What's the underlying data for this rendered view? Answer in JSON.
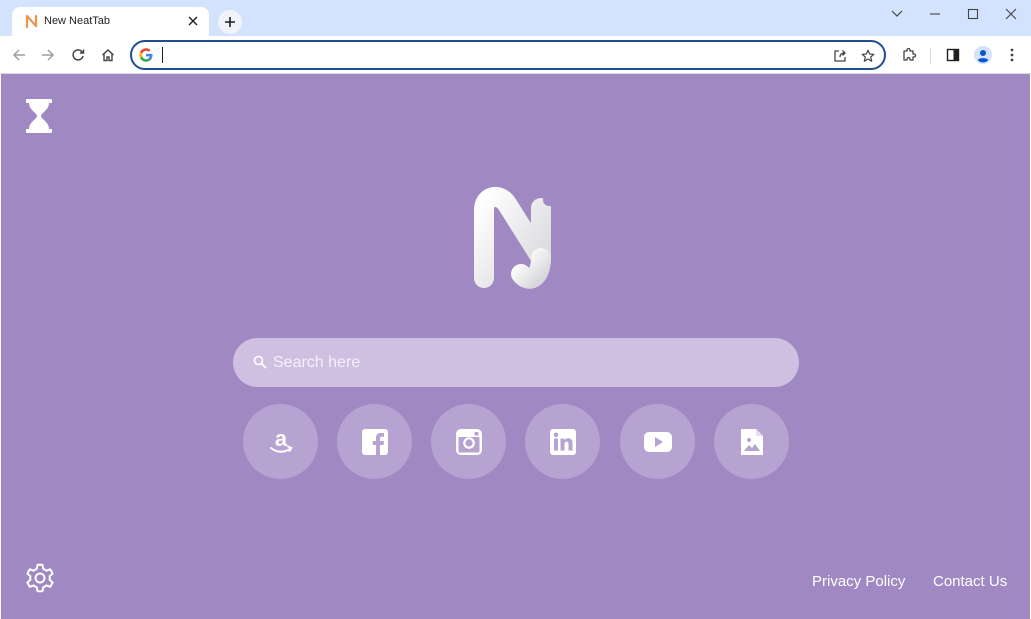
{
  "browser": {
    "tab": {
      "title": "New NeatTab"
    },
    "omnibox": {
      "value": "",
      "placeholder": ""
    }
  },
  "page": {
    "background": "#a088c2",
    "search": {
      "placeholder": "Search here"
    },
    "shortcuts": [
      {
        "name": "Amazon",
        "icon": "amazon-icon"
      },
      {
        "name": "Facebook",
        "icon": "facebook-icon"
      },
      {
        "name": "Instagram",
        "icon": "instagram-icon"
      },
      {
        "name": "LinkedIn",
        "icon": "linkedin-icon"
      },
      {
        "name": "YouTube",
        "icon": "youtube-icon"
      },
      {
        "name": "Image",
        "icon": "image-icon"
      }
    ],
    "footer": {
      "privacy": "Privacy Policy",
      "contact": "Contact Us"
    }
  }
}
